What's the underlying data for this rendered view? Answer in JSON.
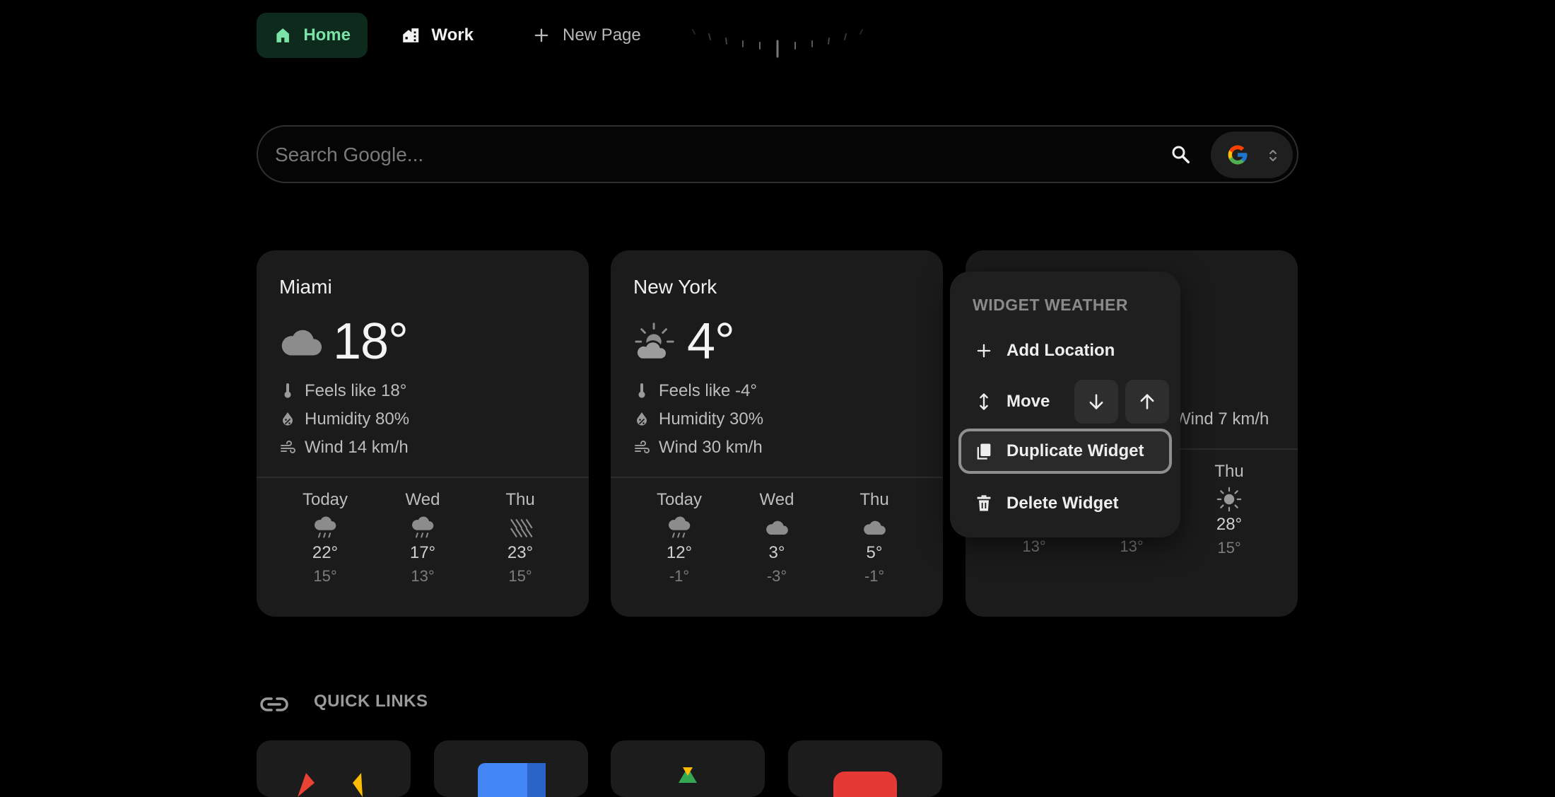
{
  "nav": {
    "tabs": [
      {
        "label": "Home",
        "icon": "home-icon",
        "active": true
      },
      {
        "label": "Work",
        "icon": "building-icon",
        "active": false
      }
    ],
    "new_page_label": "New Page"
  },
  "search": {
    "placeholder": "Search Google..."
  },
  "cards": [
    {
      "city": "Miami",
      "temp": "18°",
      "condition_icon": "cloud-icon",
      "feels": "Feels like 18°",
      "humidity": "Humidity 80%",
      "wind": "Wind 14 km/h",
      "days": [
        {
          "name": "Today",
          "icon": "rain-icon",
          "hi": "22°",
          "lo": "15°"
        },
        {
          "name": "Wed",
          "icon": "rain-icon",
          "hi": "17°",
          "lo": "13°"
        },
        {
          "name": "Thu",
          "icon": "heavy-rain-icon",
          "hi": "23°",
          "lo": "15°"
        }
      ]
    },
    {
      "city": "New York",
      "temp": "4°",
      "condition_icon": "partly-sunny-icon",
      "feels": "Feels like -4°",
      "humidity": "Humidity 30%",
      "wind": "Wind 30 km/h",
      "days": [
        {
          "name": "Today",
          "icon": "rain-icon",
          "hi": "12°",
          "lo": "-1°"
        },
        {
          "name": "Wed",
          "icon": "cloud-icon",
          "hi": "3°",
          "lo": "-3°"
        },
        {
          "name": "Thu",
          "icon": "cloud-icon",
          "hi": "5°",
          "lo": "-1°"
        }
      ]
    },
    {
      "wind": "Wind 7 km/h",
      "days": [
        {
          "lo": "13°"
        },
        {
          "lo": "13°"
        },
        {
          "name": "Thu",
          "icon": "sun-icon",
          "hi": "28°",
          "lo": "15°"
        }
      ]
    }
  ],
  "menu": {
    "title": "WIDGET WEATHER",
    "add_location": "Add Location",
    "move": "Move",
    "duplicate": "Duplicate Widget",
    "delete": "Delete Widget"
  },
  "quick_links": {
    "title": "QUICK LINKS"
  },
  "colors": {
    "accent": "#7be3a6",
    "active_tab_bg": "#0d2a1d",
    "card_bg": "#1b1b1b"
  }
}
